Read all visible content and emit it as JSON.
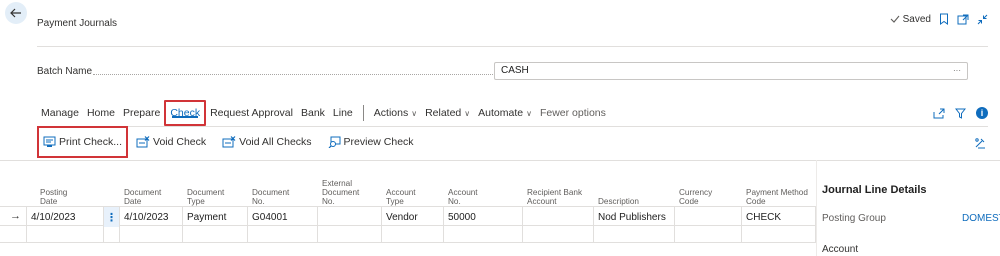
{
  "header": {
    "title": "Payment Journals",
    "saved_label": "Saved"
  },
  "batch": {
    "label": "Batch Name",
    "value": "CASH",
    "more": "···"
  },
  "action_bar": {
    "tabs": [
      "Manage",
      "Home",
      "Prepare",
      "Check",
      "Request Approval",
      "Bank",
      "Line"
    ],
    "active_tab": "Check",
    "menus": [
      "Actions",
      "Related",
      "Automate"
    ],
    "fewer_options": "Fewer options"
  },
  "check_actions": {
    "print_check": "Print Check...",
    "void_check": "Void Check",
    "void_all_checks": "Void All Checks",
    "preview_check": "Preview Check"
  },
  "grid": {
    "columns": {
      "posting_date": "Posting Date",
      "document_date": "Document Date",
      "document_type": "Document Type",
      "document_no": "Document No.",
      "external_document_no": "External Document No.",
      "account_type": "Account Type",
      "account_no": "Account No.",
      "recipient_bank_account": "Recipient Bank Account",
      "description": "Description",
      "currency_code": "Currency Code",
      "payment_method_code": "Payment Method Code"
    },
    "rows": [
      {
        "posting_date": "4/10/2023",
        "document_date": "4/10/2023",
        "document_type": "Payment",
        "document_no": "G04001",
        "external_document_no": "",
        "account_type": "Vendor",
        "account_no": "50000",
        "recipient_bank_account": "",
        "description": "Nod Publishers",
        "currency_code": "",
        "payment_method_code": "CHECK"
      }
    ]
  },
  "details_panel": {
    "title": "Journal Line Details",
    "posting_group_label": "Posting Group",
    "posting_group_value": "DOMESTIC",
    "account_label": "Account"
  },
  "colors": {
    "accent": "#0f6cbd",
    "highlight": "#d13438"
  }
}
